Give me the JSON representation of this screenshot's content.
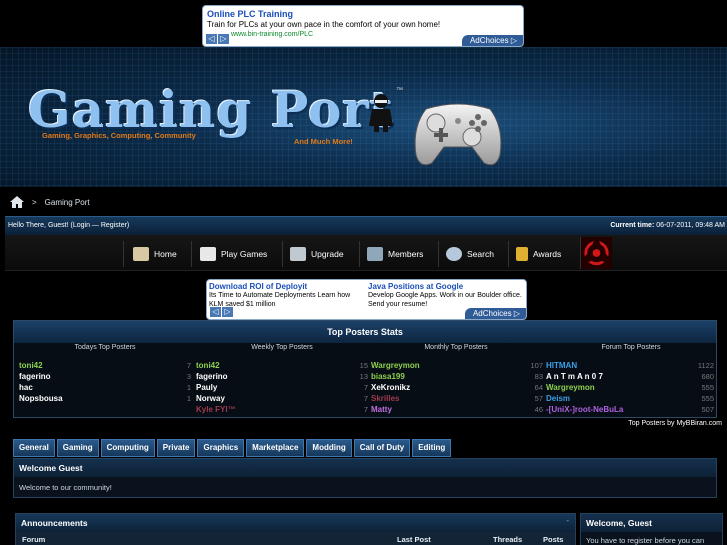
{
  "ad_top": {
    "title": "Online PLC Training",
    "text": "Train for PLCs at your own pace in the comfort of your own home!",
    "url": "www.bin-training.com/PLC",
    "choices": "AdChoices ▷",
    "nav_prev": "◁",
    "nav_next": "▷"
  },
  "banner": {
    "logo": "Gaming Port",
    "tm": "™",
    "subtitle": "Gaming, Graphics, Computing, Community",
    "tagline": "And Much More!"
  },
  "breadcrumb": {
    "separator": ">",
    "current": "Gaming Port"
  },
  "userbar": {
    "greeting": "Hello There, Guest! (Login — Register)",
    "time_label": "Current time:",
    "time_value": "06-07-2011, 09:48 AM"
  },
  "navbar": {
    "items": [
      {
        "label": "Home",
        "icon": "home-icon",
        "color": "#d9c9a3"
      },
      {
        "label": "Play Games",
        "icon": "dice-icon",
        "color": "#e8e8e8"
      },
      {
        "label": "Upgrade",
        "icon": "upgrade-icon",
        "color": "#c0c8d0"
      },
      {
        "label": "Members",
        "icon": "members-icon",
        "color": "#9ab"
      },
      {
        "label": "Search",
        "icon": "search-icon",
        "color": "#bcd"
      },
      {
        "label": "Awards",
        "icon": "trophy-icon",
        "color": "#e0b030"
      }
    ],
    "hazard_icon": "biohazard-icon"
  },
  "ad_mid": {
    "left": {
      "title": "Download ROI of Deployit",
      "text": "Its Time to Automate Deployments Learn how KLM saved $1 million"
    },
    "right": {
      "title": "Java Positions at Google",
      "text": "Develop Google Apps. Work in our Boulder office. Send your resume!"
    },
    "choices": "AdChoices ▷",
    "nav_prev": "◁",
    "nav_next": "▷"
  },
  "top_posters": {
    "title": "Top Posters Stats",
    "columns": [
      "Todays Top Posters",
      "Weekly Top Posters",
      "Monthly Top Posters",
      "Forum Top Posters"
    ],
    "today": [
      {
        "name": "toni42",
        "count": "7",
        "color": "#8fd14f"
      },
      {
        "name": "fagerino",
        "count": "3",
        "color": "#ffffff"
      },
      {
        "name": "hac",
        "count": "1",
        "color": "#ffffff"
      },
      {
        "name": "Nopsbousa",
        "count": "1",
        "color": "#ffffff"
      }
    ],
    "weekly": [
      {
        "name": "toni42",
        "count": "15",
        "color": "#8fd14f"
      },
      {
        "name": "fagerino",
        "count": "13",
        "color": "#ffffff"
      },
      {
        "name": "Pauly",
        "count": "7",
        "color": "#ffffff"
      },
      {
        "name": "Norway",
        "count": "7",
        "color": "#ffffff"
      },
      {
        "name": "Kyle FYI™",
        "count": "7",
        "color": "#a03a50"
      }
    ],
    "monthly": [
      {
        "name": "Wargreymon",
        "count": "107",
        "color": "#8fd14f"
      },
      {
        "name": "biasa199",
        "count": "83",
        "color": "#8fd14f"
      },
      {
        "name": "XeKronikz",
        "count": "64",
        "color": "#ffffff"
      },
      {
        "name": "Skrilles",
        "count": "57",
        "color": "#a03a50"
      },
      {
        "name": "Matty",
        "count": "46",
        "color": "#c070e0"
      }
    ],
    "forum": [
      {
        "name": "HITMAN",
        "count": "1122",
        "color": "#3aa0e8"
      },
      {
        "name": "A n T m A n 0 7",
        "count": "680",
        "color": "#ffffff"
      },
      {
        "name": "Wargreymon",
        "count": "555",
        "color": "#8fd14f"
      },
      {
        "name": "Deism",
        "count": "555",
        "color": "#3aa0e8"
      },
      {
        "name": "-[UniX-]root-NeBuLa",
        "count": "507",
        "color": "#b060e0"
      }
    ],
    "footer": "Top Posters by MyBBiran.com"
  },
  "tabs": [
    "General",
    "Gaming",
    "Computing",
    "Private",
    "Graphics",
    "Marketplace",
    "Modding",
    "Call of Duty",
    "Editing"
  ],
  "welcome": {
    "title": "Welcome Guest",
    "body": "Welcome to our community!"
  },
  "announcements": {
    "title": "Announcements",
    "collapse": "-",
    "col_forum": "Forum",
    "col_last": "Last Post",
    "col_threads": "Threads",
    "col_posts": "Posts"
  },
  "side_welcome": {
    "title": "Welcome, Guest",
    "body": "You have to register before you can"
  }
}
